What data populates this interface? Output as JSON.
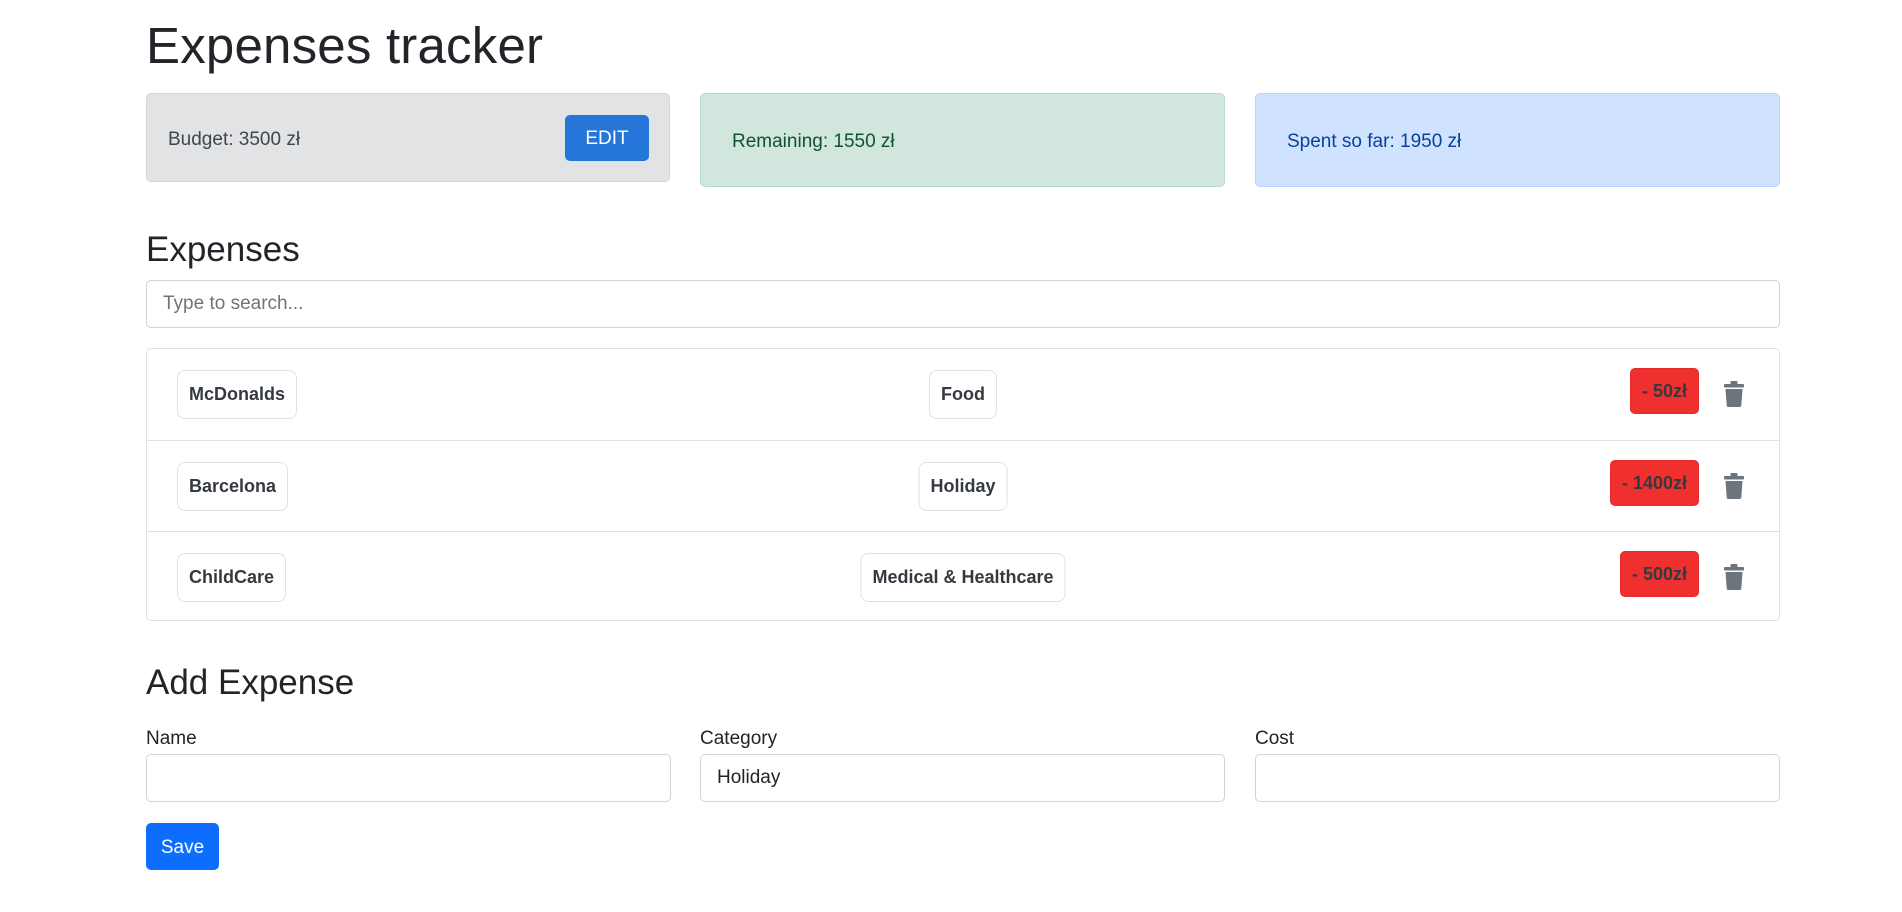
{
  "header": {
    "title": "Expenses tracker"
  },
  "summary": {
    "budget_text": "Budget: 3500 zł",
    "edit_label": "EDIT",
    "remaining_text": "Remaining: 1550 zł",
    "spent_text": "Spent so far: 1950 zł"
  },
  "expenses": {
    "heading": "Expenses",
    "search_placeholder": "Type to search...",
    "search_value": "",
    "items": [
      {
        "name": "McDonalds",
        "category": "Food",
        "cost": "- 50zł"
      },
      {
        "name": "Barcelona",
        "category": "Holiday",
        "cost": "- 1400zł"
      },
      {
        "name": "ChildCare",
        "category": "Medical & Healthcare",
        "cost": "- 500zł"
      }
    ],
    "delete_icon": "trash-icon"
  },
  "add_expense": {
    "heading": "Add Expense",
    "name_label": "Name",
    "name_value": "",
    "category_label": "Category",
    "category_value": "Holiday",
    "cost_label": "Cost",
    "cost_value": "",
    "save_label": "Save"
  },
  "colors": {
    "budget_bg": "#e2e3e5",
    "remaining_bg": "#d1e7dd",
    "spent_bg": "#cfe2ff",
    "edit_button": "#2476d8",
    "cost_badge": "#ef302e",
    "save_button": "#0d6efd"
  }
}
